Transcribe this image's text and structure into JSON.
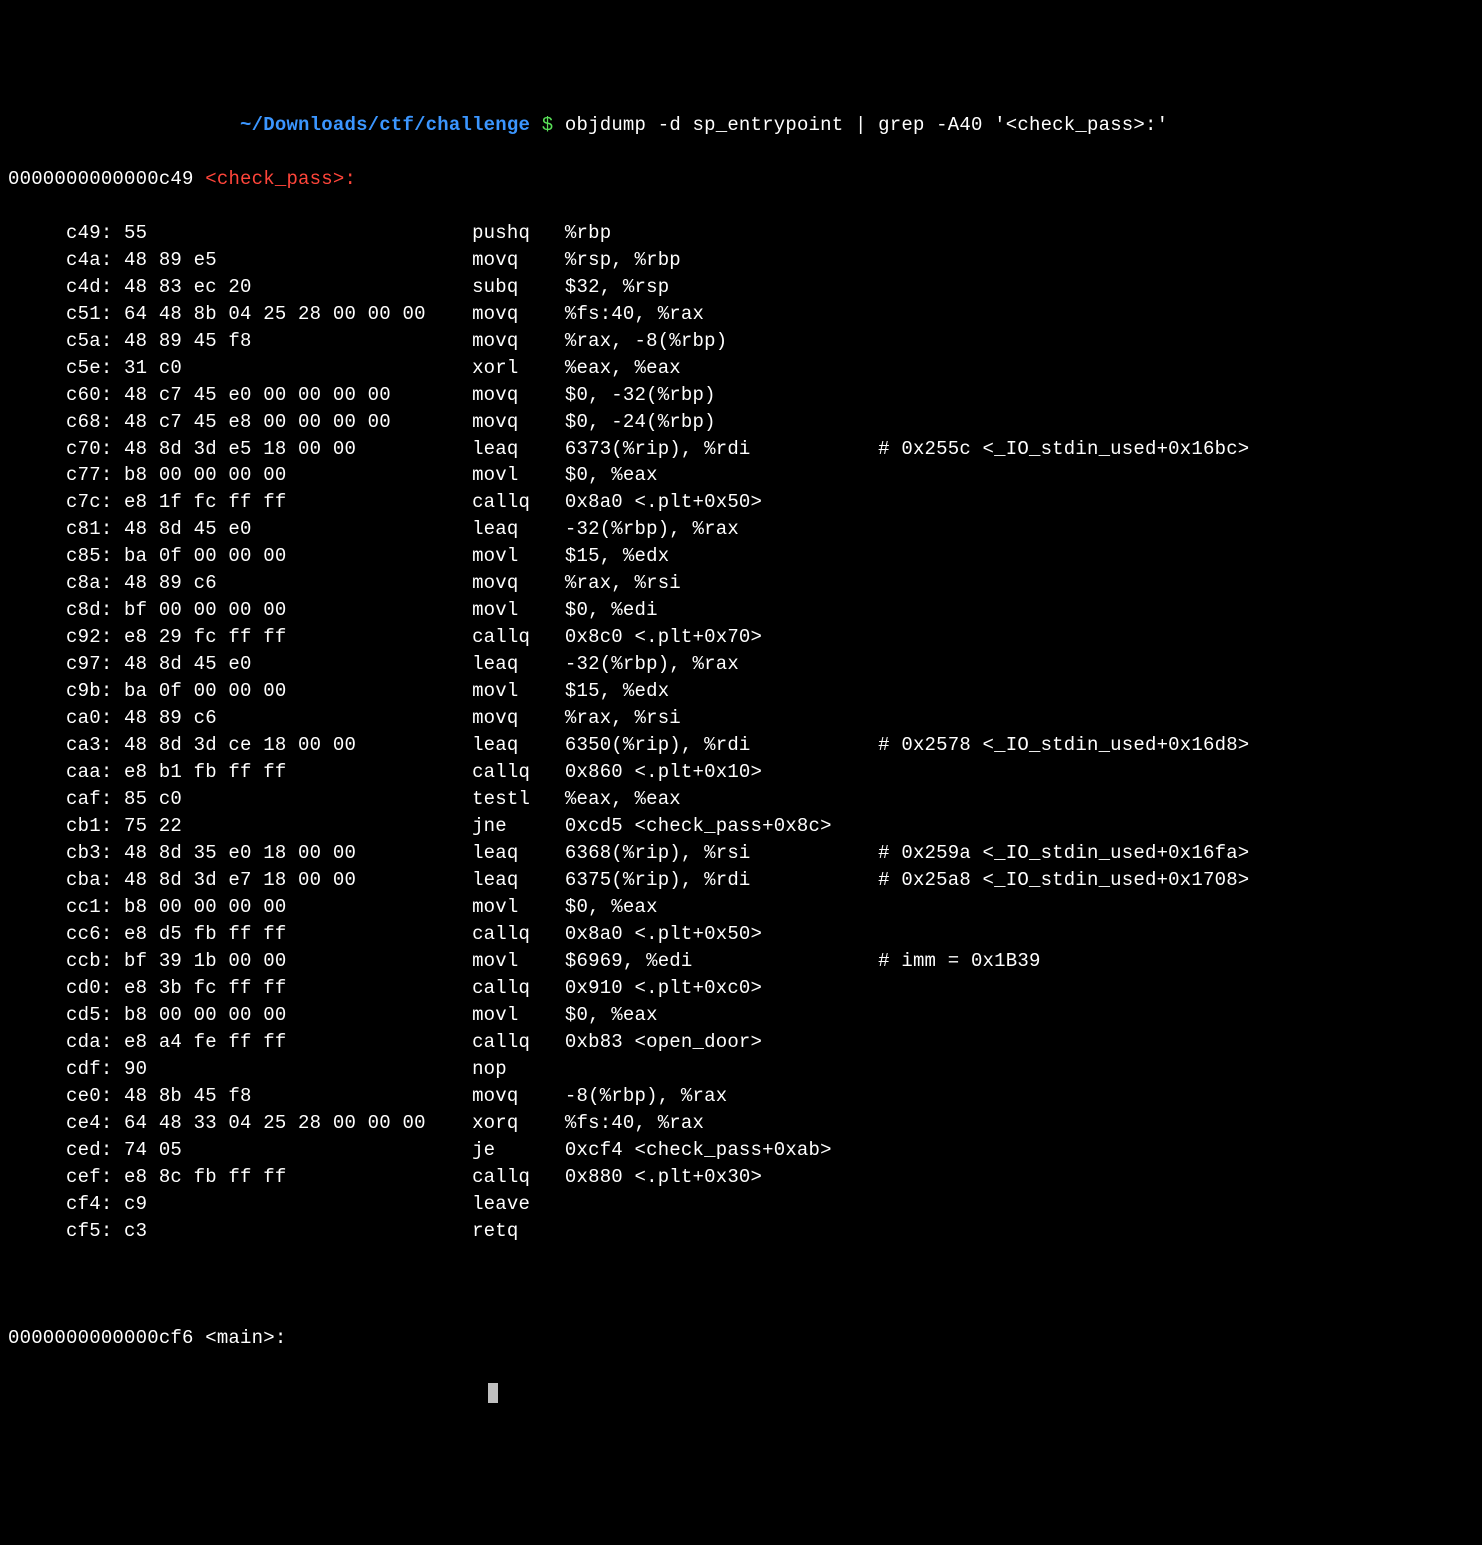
{
  "prompt": {
    "path": "~/Downloads/ctf/challenge",
    "dollar": " $ ",
    "command": "objdump -d sp_entrypoint | grep -A40 '<check_pass>:'"
  },
  "header": {
    "addr": "0000000000000c49 ",
    "label": "<check_pass>:"
  },
  "lines": [
    {
      "addr": "     c49:",
      "bytes": " 55                           ",
      "mnemonic": " pushq",
      "ops": "   %rbp",
      "comment": ""
    },
    {
      "addr": "     c4a:",
      "bytes": " 48 89 e5                     ",
      "mnemonic": " movq ",
      "ops": "   %rsp, %rbp",
      "comment": ""
    },
    {
      "addr": "     c4d:",
      "bytes": " 48 83 ec 20                  ",
      "mnemonic": " subq ",
      "ops": "   $32, %rsp",
      "comment": ""
    },
    {
      "addr": "     c51:",
      "bytes": " 64 48 8b 04 25 28 00 00 00   ",
      "mnemonic": " movq ",
      "ops": "   %fs:40, %rax",
      "comment": ""
    },
    {
      "addr": "     c5a:",
      "bytes": " 48 89 45 f8                  ",
      "mnemonic": " movq ",
      "ops": "   %rax, -8(%rbp)",
      "comment": ""
    },
    {
      "addr": "     c5e:",
      "bytes": " 31 c0                        ",
      "mnemonic": " xorl ",
      "ops": "   %eax, %eax",
      "comment": ""
    },
    {
      "addr": "     c60:",
      "bytes": " 48 c7 45 e0 00 00 00 00      ",
      "mnemonic": " movq ",
      "ops": "   $0, -32(%rbp)",
      "comment": ""
    },
    {
      "addr": "     c68:",
      "bytes": " 48 c7 45 e8 00 00 00 00      ",
      "mnemonic": " movq ",
      "ops": "   $0, -24(%rbp)",
      "comment": ""
    },
    {
      "addr": "     c70:",
      "bytes": " 48 8d 3d e5 18 00 00         ",
      "mnemonic": " leaq ",
      "ops": "   6373(%rip), %rdi           ",
      "comment": "# 0x255c <_IO_stdin_used+0x16bc>"
    },
    {
      "addr": "     c77:",
      "bytes": " b8 00 00 00 00               ",
      "mnemonic": " movl ",
      "ops": "   $0, %eax",
      "comment": ""
    },
    {
      "addr": "     c7c:",
      "bytes": " e8 1f fc ff ff               ",
      "mnemonic": " callq",
      "ops": "   0x8a0 <.plt+0x50>",
      "comment": ""
    },
    {
      "addr": "     c81:",
      "bytes": " 48 8d 45 e0                  ",
      "mnemonic": " leaq ",
      "ops": "   -32(%rbp), %rax",
      "comment": ""
    },
    {
      "addr": "     c85:",
      "bytes": " ba 0f 00 00 00               ",
      "mnemonic": " movl ",
      "ops": "   $15, %edx",
      "comment": ""
    },
    {
      "addr": "     c8a:",
      "bytes": " 48 89 c6                     ",
      "mnemonic": " movq ",
      "ops": "   %rax, %rsi",
      "comment": ""
    },
    {
      "addr": "     c8d:",
      "bytes": " bf 00 00 00 00               ",
      "mnemonic": " movl ",
      "ops": "   $0, %edi",
      "comment": ""
    },
    {
      "addr": "     c92:",
      "bytes": " e8 29 fc ff ff               ",
      "mnemonic": " callq",
      "ops": "   0x8c0 <.plt+0x70>",
      "comment": ""
    },
    {
      "addr": "     c97:",
      "bytes": " 48 8d 45 e0                  ",
      "mnemonic": " leaq ",
      "ops": "   -32(%rbp), %rax",
      "comment": ""
    },
    {
      "addr": "     c9b:",
      "bytes": " ba 0f 00 00 00               ",
      "mnemonic": " movl ",
      "ops": "   $15, %edx",
      "comment": ""
    },
    {
      "addr": "     ca0:",
      "bytes": " 48 89 c6                     ",
      "mnemonic": " movq ",
      "ops": "   %rax, %rsi",
      "comment": ""
    },
    {
      "addr": "     ca3:",
      "bytes": " 48 8d 3d ce 18 00 00         ",
      "mnemonic": " leaq ",
      "ops": "   6350(%rip), %rdi           ",
      "comment": "# 0x2578 <_IO_stdin_used+0x16d8>"
    },
    {
      "addr": "     caa:",
      "bytes": " e8 b1 fb ff ff               ",
      "mnemonic": " callq",
      "ops": "   0x860 <.plt+0x10>",
      "comment": ""
    },
    {
      "addr": "     caf:",
      "bytes": " 85 c0                        ",
      "mnemonic": " testl",
      "ops": "   %eax, %eax",
      "comment": ""
    },
    {
      "addr": "     cb1:",
      "bytes": " 75 22                        ",
      "mnemonic": " jne  ",
      "ops": "   0xcd5 <check_pass+0x8c>",
      "comment": ""
    },
    {
      "addr": "     cb3:",
      "bytes": " 48 8d 35 e0 18 00 00         ",
      "mnemonic": " leaq ",
      "ops": "   6368(%rip), %rsi           ",
      "comment": "# 0x259a <_IO_stdin_used+0x16fa>"
    },
    {
      "addr": "     cba:",
      "bytes": " 48 8d 3d e7 18 00 00         ",
      "mnemonic": " leaq ",
      "ops": "   6375(%rip), %rdi           ",
      "comment": "# 0x25a8 <_IO_stdin_used+0x1708>"
    },
    {
      "addr": "     cc1:",
      "bytes": " b8 00 00 00 00               ",
      "mnemonic": " movl ",
      "ops": "   $0, %eax",
      "comment": ""
    },
    {
      "addr": "     cc6:",
      "bytes": " e8 d5 fb ff ff               ",
      "mnemonic": " callq",
      "ops": "   0x8a0 <.plt+0x50>",
      "comment": ""
    },
    {
      "addr": "     ccb:",
      "bytes": " bf 39 1b 00 00               ",
      "mnemonic": " movl ",
      "ops": "   $6969, %edi                ",
      "comment": "# imm = 0x1B39"
    },
    {
      "addr": "     cd0:",
      "bytes": " e8 3b fc ff ff               ",
      "mnemonic": " callq",
      "ops": "   0x910 <.plt+0xc0>",
      "comment": ""
    },
    {
      "addr": "     cd5:",
      "bytes": " b8 00 00 00 00               ",
      "mnemonic": " movl ",
      "ops": "   $0, %eax",
      "comment": ""
    },
    {
      "addr": "     cda:",
      "bytes": " e8 a4 fe ff ff               ",
      "mnemonic": " callq",
      "ops": "   0xb83 <open_door>",
      "comment": ""
    },
    {
      "addr": "     cdf:",
      "bytes": " 90                           ",
      "mnemonic": " nop  ",
      "ops": "",
      "comment": ""
    },
    {
      "addr": "     ce0:",
      "bytes": " 48 8b 45 f8                  ",
      "mnemonic": " movq ",
      "ops": "   -8(%rbp), %rax",
      "comment": ""
    },
    {
      "addr": "     ce4:",
      "bytes": " 64 48 33 04 25 28 00 00 00   ",
      "mnemonic": " xorq ",
      "ops": "   %fs:40, %rax",
      "comment": ""
    },
    {
      "addr": "     ced:",
      "bytes": " 74 05                        ",
      "mnemonic": " je   ",
      "ops": "   0xcf4 <check_pass+0xab>",
      "comment": ""
    },
    {
      "addr": "     cef:",
      "bytes": " e8 8c fb ff ff               ",
      "mnemonic": " callq",
      "ops": "   0x880 <.plt+0x30>",
      "comment": ""
    },
    {
      "addr": "     cf4:",
      "bytes": " c9                           ",
      "mnemonic": " leave",
      "ops": "",
      "comment": ""
    },
    {
      "addr": "     cf5:",
      "bytes": " c3                           ",
      "mnemonic": " retq ",
      "ops": "",
      "comment": ""
    }
  ],
  "footer": {
    "full": "0000000000000cf6 <main>:"
  }
}
